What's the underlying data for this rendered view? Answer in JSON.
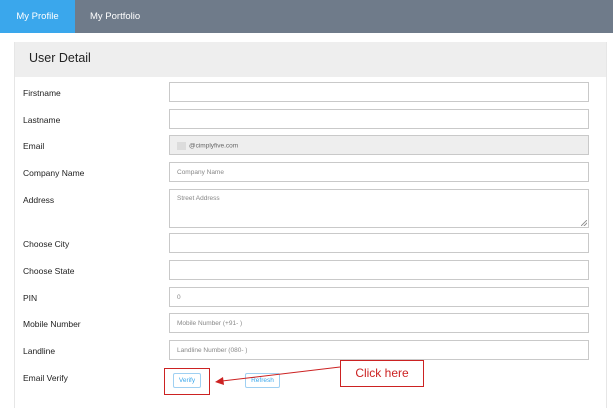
{
  "tabs": [
    {
      "label": "My Profile",
      "active": true
    },
    {
      "label": "My Portfolio",
      "active": false
    }
  ],
  "panel": {
    "title": "User Detail"
  },
  "form": {
    "firstname": {
      "label": "Firstname",
      "value": "",
      "placeholder": ""
    },
    "lastname": {
      "label": "Lastname",
      "value": "",
      "placeholder": ""
    },
    "email": {
      "label": "Email",
      "value": "@cimplyfive.com",
      "disabled": true
    },
    "company": {
      "label": "Company Name",
      "placeholder": "Company Name"
    },
    "address": {
      "label": "Address",
      "placeholder": "Street Address"
    },
    "city": {
      "label": "Choose City",
      "value": ""
    },
    "state": {
      "label": "Choose State",
      "value": ""
    },
    "pin": {
      "label": "PIN",
      "value": "0"
    },
    "mobile": {
      "label": "Mobile Number",
      "placeholder": "Mobile Number (+91-                )"
    },
    "landline": {
      "label": "Landline",
      "placeholder": "Landline Number (080-                )"
    },
    "email_verify": {
      "label": "Email Verify",
      "verify_label": "Verify",
      "refresh_label": "Refresh"
    }
  },
  "annotation": {
    "callout_text": "Click here",
    "color": "#cc2222"
  },
  "colors": {
    "accent": "#3aa7ec",
    "topbar": "#6f7b8a",
    "panel_header": "#eeeeee"
  }
}
